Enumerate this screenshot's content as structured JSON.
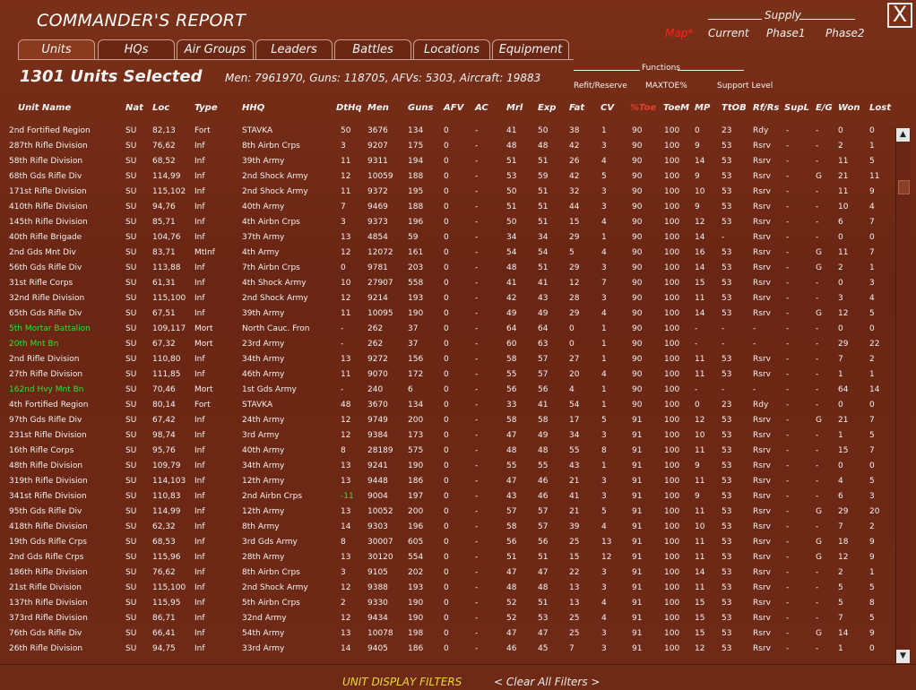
{
  "window": {
    "title": "COMMANDER'S REPORT",
    "close_label": "X"
  },
  "map_link": "Map*",
  "supply": {
    "title": "Supply",
    "options": [
      "Current",
      "Phase1",
      "Phase2"
    ]
  },
  "tabs": [
    "Units",
    "HQs",
    "Air Groups",
    "Leaders",
    "Battles",
    "Locations",
    "Equipment"
  ],
  "active_tab": "Units",
  "selection": {
    "count_label": "1301 Units Selected",
    "summary": "Men: 7961970, Guns: 118705, AFVs: 5303, Aircraft: 19883"
  },
  "functions": {
    "title": "Functions",
    "items": [
      "Refit/Reserve",
      "MAXTOE%",
      "Support Level"
    ]
  },
  "columns": [
    "Unit Name",
    "Nat",
    "Loc",
    "Type",
    "HHQ",
    "DtHq",
    "Men",
    "Guns",
    "AFV",
    "AC",
    "Mrl",
    "Exp",
    "Fat",
    "CV",
    "%Toe",
    "ToeM",
    "MP",
    "TtOB",
    "Rf/Rs",
    "SupL",
    "E/G",
    "Won",
    "Lost"
  ],
  "rows": [
    {
      "name": "2nd Fortified Region",
      "nat": "SU",
      "loc": "82,13",
      "type": "Fort",
      "hhq": "STAVKA",
      "dthq": "50",
      "men": "3676",
      "guns": "134",
      "afv": "0",
      "ac": "-",
      "mrl": "41",
      "exp": "50",
      "fat": "38",
      "cv": "1",
      "toe": "90",
      "toem": "100",
      "mp": "0",
      "ttob": "23",
      "rf": "Rdy",
      "supl": "-",
      "eg": "-",
      "won": "0",
      "lost": "0",
      "green": false
    },
    {
      "name": "287th Rifle Division",
      "nat": "SU",
      "loc": "76,62",
      "type": "Inf",
      "hhq": "8th Airbn Crps",
      "dthq": "3",
      "men": "9207",
      "guns": "175",
      "afv": "0",
      "ac": "-",
      "mrl": "48",
      "exp": "48",
      "fat": "42",
      "cv": "3",
      "toe": "90",
      "toem": "100",
      "mp": "9",
      "ttob": "53",
      "rf": "Rsrv",
      "supl": "-",
      "eg": "-",
      "won": "2",
      "lost": "1",
      "green": false
    },
    {
      "name": "58th Rifle Division",
      "nat": "SU",
      "loc": "68,52",
      "type": "Inf",
      "hhq": "39th Army",
      "dthq": "11",
      "men": "9311",
      "guns": "194",
      "afv": "0",
      "ac": "-",
      "mrl": "51",
      "exp": "51",
      "fat": "26",
      "cv": "4",
      "toe": "90",
      "toem": "100",
      "mp": "14",
      "ttob": "53",
      "rf": "Rsrv",
      "supl": "-",
      "eg": "-",
      "won": "11",
      "lost": "5",
      "green": false
    },
    {
      "name": "68th Gds Rifle Div",
      "nat": "SU",
      "loc": "114,99",
      "type": "Inf",
      "hhq": "2nd Shock Army",
      "dthq": "12",
      "men": "10059",
      "guns": "188",
      "afv": "0",
      "ac": "-",
      "mrl": "53",
      "exp": "59",
      "fat": "42",
      "cv": "5",
      "toe": "90",
      "toem": "100",
      "mp": "9",
      "ttob": "53",
      "rf": "Rsrv",
      "supl": "-",
      "eg": "G",
      "won": "21",
      "lost": "11",
      "green": false
    },
    {
      "name": "171st Rifle Division",
      "nat": "SU",
      "loc": "115,102",
      "type": "Inf",
      "hhq": "2nd Shock Army",
      "dthq": "11",
      "men": "9372",
      "guns": "195",
      "afv": "0",
      "ac": "-",
      "mrl": "50",
      "exp": "51",
      "fat": "32",
      "cv": "3",
      "toe": "90",
      "toem": "100",
      "mp": "10",
      "ttob": "53",
      "rf": "Rsrv",
      "supl": "-",
      "eg": "-",
      "won": "11",
      "lost": "9",
      "green": false
    },
    {
      "name": "410th Rifle Division",
      "nat": "SU",
      "loc": "94,76",
      "type": "Inf",
      "hhq": "40th Army",
      "dthq": "7",
      "men": "9469",
      "guns": "188",
      "afv": "0",
      "ac": "-",
      "mrl": "51",
      "exp": "51",
      "fat": "44",
      "cv": "3",
      "toe": "90",
      "toem": "100",
      "mp": "9",
      "ttob": "53",
      "rf": "Rsrv",
      "supl": "-",
      "eg": "-",
      "won": "10",
      "lost": "4",
      "green": false
    },
    {
      "name": "145th Rifle Division",
      "nat": "SU",
      "loc": "85,71",
      "type": "Inf",
      "hhq": "4th Airbn Crps",
      "dthq": "3",
      "men": "9373",
      "guns": "196",
      "afv": "0",
      "ac": "-",
      "mrl": "50",
      "exp": "51",
      "fat": "15",
      "cv": "4",
      "toe": "90",
      "toem": "100",
      "mp": "12",
      "ttob": "53",
      "rf": "Rsrv",
      "supl": "-",
      "eg": "-",
      "won": "6",
      "lost": "7",
      "green": false
    },
    {
      "name": "40th Rifle Brigade",
      "nat": "SU",
      "loc": "104,76",
      "type": "Inf",
      "hhq": "37th Army",
      "dthq": "13",
      "men": "4854",
      "guns": "59",
      "afv": "0",
      "ac": "-",
      "mrl": "34",
      "exp": "34",
      "fat": "29",
      "cv": "1",
      "toe": "90",
      "toem": "100",
      "mp": "14",
      "ttob": "-",
      "rf": "Rsrv",
      "supl": "-",
      "eg": "-",
      "won": "0",
      "lost": "0",
      "green": false
    },
    {
      "name": "2nd Gds Mnt Div",
      "nat": "SU",
      "loc": "83,71",
      "type": "MtInf",
      "hhq": "4th Army",
      "dthq": "12",
      "men": "12072",
      "guns": "161",
      "afv": "0",
      "ac": "-",
      "mrl": "54",
      "exp": "54",
      "fat": "5",
      "cv": "4",
      "toe": "90",
      "toem": "100",
      "mp": "16",
      "ttob": "53",
      "rf": "Rsrv",
      "supl": "-",
      "eg": "G",
      "won": "11",
      "lost": "7",
      "green": false
    },
    {
      "name": "56th Gds Rifle Div",
      "nat": "SU",
      "loc": "113,88",
      "type": "Inf",
      "hhq": "7th Airbn Crps",
      "dthq": "0",
      "men": "9781",
      "guns": "203",
      "afv": "0",
      "ac": "-",
      "mrl": "48",
      "exp": "51",
      "fat": "29",
      "cv": "3",
      "toe": "90",
      "toem": "100",
      "mp": "14",
      "ttob": "53",
      "rf": "Rsrv",
      "supl": "-",
      "eg": "G",
      "won": "2",
      "lost": "1",
      "green": false
    },
    {
      "name": "31st Rifle Corps",
      "nat": "SU",
      "loc": "61,31",
      "type": "Inf",
      "hhq": "4th Shock Army",
      "dthq": "10",
      "men": "27907",
      "guns": "558",
      "afv": "0",
      "ac": "-",
      "mrl": "41",
      "exp": "41",
      "fat": "12",
      "cv": "7",
      "toe": "90",
      "toem": "100",
      "mp": "15",
      "ttob": "53",
      "rf": "Rsrv",
      "supl": "-",
      "eg": "-",
      "won": "0",
      "lost": "3",
      "green": false
    },
    {
      "name": "32nd Rifle Division",
      "nat": "SU",
      "loc": "115,100",
      "type": "Inf",
      "hhq": "2nd Shock Army",
      "dthq": "12",
      "men": "9214",
      "guns": "193",
      "afv": "0",
      "ac": "-",
      "mrl": "42",
      "exp": "43",
      "fat": "28",
      "cv": "3",
      "toe": "90",
      "toem": "100",
      "mp": "11",
      "ttob": "53",
      "rf": "Rsrv",
      "supl": "-",
      "eg": "-",
      "won": "3",
      "lost": "4",
      "green": false
    },
    {
      "name": "65th Gds Rifle Div",
      "nat": "SU",
      "loc": "67,51",
      "type": "Inf",
      "hhq": "39th Army",
      "dthq": "11",
      "men": "10095",
      "guns": "190",
      "afv": "0",
      "ac": "-",
      "mrl": "49",
      "exp": "49",
      "fat": "29",
      "cv": "4",
      "toe": "90",
      "toem": "100",
      "mp": "14",
      "ttob": "53",
      "rf": "Rsrv",
      "supl": "-",
      "eg": "G",
      "won": "12",
      "lost": "5",
      "green": false
    },
    {
      "name": "5th Mortar Battalion",
      "nat": "SU",
      "loc": "109,117",
      "type": "Mort",
      "hhq": "North Cauc. Fron",
      "dthq": "-",
      "men": "262",
      "guns": "37",
      "afv": "0",
      "ac": "-",
      "mrl": "64",
      "exp": "64",
      "fat": "0",
      "cv": "1",
      "toe": "90",
      "toem": "100",
      "mp": "-",
      "ttob": "-",
      "rf": "-",
      "supl": "-",
      "eg": "-",
      "won": "0",
      "lost": "0",
      "green": true
    },
    {
      "name": "20th Mnt Bn",
      "nat": "SU",
      "loc": "67,32",
      "type": "Mort",
      "hhq": "23rd Army",
      "dthq": "-",
      "men": "262",
      "guns": "37",
      "afv": "0",
      "ac": "-",
      "mrl": "60",
      "exp": "63",
      "fat": "0",
      "cv": "1",
      "toe": "90",
      "toem": "100",
      "mp": "-",
      "ttob": "-",
      "rf": "-",
      "supl": "-",
      "eg": "-",
      "won": "29",
      "lost": "22",
      "green": true
    },
    {
      "name": "2nd Rifle Division",
      "nat": "SU",
      "loc": "110,80",
      "type": "Inf",
      "hhq": "34th Army",
      "dthq": "13",
      "men": "9272",
      "guns": "156",
      "afv": "0",
      "ac": "-",
      "mrl": "58",
      "exp": "57",
      "fat": "27",
      "cv": "1",
      "toe": "90",
      "toem": "100",
      "mp": "11",
      "ttob": "53",
      "rf": "Rsrv",
      "supl": "-",
      "eg": "-",
      "won": "7",
      "lost": "2",
      "green": false
    },
    {
      "name": "27th Rifle Division",
      "nat": "SU",
      "loc": "111,85",
      "type": "Inf",
      "hhq": "46th Army",
      "dthq": "11",
      "men": "9070",
      "guns": "172",
      "afv": "0",
      "ac": "-",
      "mrl": "55",
      "exp": "57",
      "fat": "20",
      "cv": "4",
      "toe": "90",
      "toem": "100",
      "mp": "11",
      "ttob": "53",
      "rf": "Rsrv",
      "supl": "-",
      "eg": "-",
      "won": "1",
      "lost": "1",
      "green": false
    },
    {
      "name": "162nd Hvy Mnt Bn",
      "nat": "SU",
      "loc": "70,46",
      "type": "Mort",
      "hhq": "1st Gds Army",
      "dthq": "-",
      "men": "240",
      "guns": "6",
      "afv": "0",
      "ac": "-",
      "mrl": "56",
      "exp": "56",
      "fat": "4",
      "cv": "1",
      "toe": "90",
      "toem": "100",
      "mp": "-",
      "ttob": "-",
      "rf": "-",
      "supl": "-",
      "eg": "-",
      "won": "64",
      "lost": "14",
      "green": true
    },
    {
      "name": "4th Fortified Region",
      "nat": "SU",
      "loc": "80,14",
      "type": "Fort",
      "hhq": "STAVKA",
      "dthq": "48",
      "men": "3670",
      "guns": "134",
      "afv": "0",
      "ac": "-",
      "mrl": "33",
      "exp": "41",
      "fat": "54",
      "cv": "1",
      "toe": "90",
      "toem": "100",
      "mp": "0",
      "ttob": "23",
      "rf": "Rdy",
      "supl": "-",
      "eg": "-",
      "won": "0",
      "lost": "0",
      "green": false
    },
    {
      "name": "97th Gds Rifle Div",
      "nat": "SU",
      "loc": "67,42",
      "type": "Inf",
      "hhq": "24th Army",
      "dthq": "12",
      "men": "9749",
      "guns": "200",
      "afv": "0",
      "ac": "-",
      "mrl": "58",
      "exp": "58",
      "fat": "17",
      "cv": "5",
      "toe": "91",
      "toem": "100",
      "mp": "12",
      "ttob": "53",
      "rf": "Rsrv",
      "supl": "-",
      "eg": "G",
      "won": "21",
      "lost": "7",
      "green": false
    },
    {
      "name": "231st Rifle Division",
      "nat": "SU",
      "loc": "98,74",
      "type": "Inf",
      "hhq": "3rd Army",
      "dthq": "12",
      "men": "9384",
      "guns": "173",
      "afv": "0",
      "ac": "-",
      "mrl": "47",
      "exp": "49",
      "fat": "34",
      "cv": "3",
      "toe": "91",
      "toem": "100",
      "mp": "10",
      "ttob": "53",
      "rf": "Rsrv",
      "supl": "-",
      "eg": "-",
      "won": "1",
      "lost": "5",
      "green": false
    },
    {
      "name": "16th Rifle Corps",
      "nat": "SU",
      "loc": "95,76",
      "type": "Inf",
      "hhq": "40th Army",
      "dthq": "8",
      "men": "28189",
      "guns": "575",
      "afv": "0",
      "ac": "-",
      "mrl": "48",
      "exp": "48",
      "fat": "55",
      "cv": "8",
      "toe": "91",
      "toem": "100",
      "mp": "11",
      "ttob": "53",
      "rf": "Rsrv",
      "supl": "-",
      "eg": "-",
      "won": "15",
      "lost": "7",
      "green": false
    },
    {
      "name": "48th Rifle Division",
      "nat": "SU",
      "loc": "109,79",
      "type": "Inf",
      "hhq": "34th Army",
      "dthq": "13",
      "men": "9241",
      "guns": "190",
      "afv": "0",
      "ac": "-",
      "mrl": "55",
      "exp": "55",
      "fat": "43",
      "cv": "1",
      "toe": "91",
      "toem": "100",
      "mp": "9",
      "ttob": "53",
      "rf": "Rsrv",
      "supl": "-",
      "eg": "-",
      "won": "0",
      "lost": "0",
      "green": false
    },
    {
      "name": "319th Rifle Division",
      "nat": "SU",
      "loc": "114,103",
      "type": "Inf",
      "hhq": "12th Army",
      "dthq": "13",
      "men": "9448",
      "guns": "186",
      "afv": "0",
      "ac": "-",
      "mrl": "47",
      "exp": "46",
      "fat": "21",
      "cv": "3",
      "toe": "91",
      "toem": "100",
      "mp": "11",
      "ttob": "53",
      "rf": "Rsrv",
      "supl": "-",
      "eg": "-",
      "won": "4",
      "lost": "5",
      "green": false
    },
    {
      "name": "341st Rifle Division",
      "nat": "SU",
      "loc": "110,83",
      "type": "Inf",
      "hhq": "2nd Airbn Crps",
      "dthq": "-11",
      "men": "9004",
      "guns": "197",
      "afv": "0",
      "ac": "-",
      "mrl": "43",
      "exp": "46",
      "fat": "41",
      "cv": "3",
      "toe": "91",
      "toem": "100",
      "mp": "9",
      "ttob": "53",
      "rf": "Rsrv",
      "supl": "-",
      "eg": "-",
      "won": "6",
      "lost": "3",
      "green": false
    },
    {
      "name": "95th Gds Rifle Div",
      "nat": "SU",
      "loc": "114,99",
      "type": "Inf",
      "hhq": "12th Army",
      "dthq": "13",
      "men": "10052",
      "guns": "200",
      "afv": "0",
      "ac": "-",
      "mrl": "57",
      "exp": "57",
      "fat": "21",
      "cv": "5",
      "toe": "91",
      "toem": "100",
      "mp": "11",
      "ttob": "53",
      "rf": "Rsrv",
      "supl": "-",
      "eg": "G",
      "won": "29",
      "lost": "20",
      "green": false
    },
    {
      "name": "418th Rifle Division",
      "nat": "SU",
      "loc": "62,32",
      "type": "Inf",
      "hhq": "8th Army",
      "dthq": "14",
      "men": "9303",
      "guns": "196",
      "afv": "0",
      "ac": "-",
      "mrl": "58",
      "exp": "57",
      "fat": "39",
      "cv": "4",
      "toe": "91",
      "toem": "100",
      "mp": "10",
      "ttob": "53",
      "rf": "Rsrv",
      "supl": "-",
      "eg": "-",
      "won": "7",
      "lost": "2",
      "green": false
    },
    {
      "name": "19th Gds Rifle Crps",
      "nat": "SU",
      "loc": "68,53",
      "type": "Inf",
      "hhq": "3rd Gds Army",
      "dthq": "8",
      "men": "30007",
      "guns": "605",
      "afv": "0",
      "ac": "-",
      "mrl": "56",
      "exp": "56",
      "fat": "25",
      "cv": "13",
      "toe": "91",
      "toem": "100",
      "mp": "11",
      "ttob": "53",
      "rf": "Rsrv",
      "supl": "-",
      "eg": "G",
      "won": "18",
      "lost": "9",
      "green": false
    },
    {
      "name": "2nd Gds Rifle Crps",
      "nat": "SU",
      "loc": "115,96",
      "type": "Inf",
      "hhq": "28th Army",
      "dthq": "13",
      "men": "30120",
      "guns": "554",
      "afv": "0",
      "ac": "-",
      "mrl": "51",
      "exp": "51",
      "fat": "15",
      "cv": "12",
      "toe": "91",
      "toem": "100",
      "mp": "11",
      "ttob": "53",
      "rf": "Rsrv",
      "supl": "-",
      "eg": "G",
      "won": "12",
      "lost": "9",
      "green": false
    },
    {
      "name": "186th Rifle Division",
      "nat": "SU",
      "loc": "76,62",
      "type": "Inf",
      "hhq": "8th Airbn Crps",
      "dthq": "3",
      "men": "9105",
      "guns": "202",
      "afv": "0",
      "ac": "-",
      "mrl": "47",
      "exp": "47",
      "fat": "22",
      "cv": "3",
      "toe": "91",
      "toem": "100",
      "mp": "14",
      "ttob": "53",
      "rf": "Rsrv",
      "supl": "-",
      "eg": "-",
      "won": "2",
      "lost": "1",
      "green": false
    },
    {
      "name": "21st Rifle Division",
      "nat": "SU",
      "loc": "115,100",
      "type": "Inf",
      "hhq": "2nd Shock Army",
      "dthq": "12",
      "men": "9388",
      "guns": "193",
      "afv": "0",
      "ac": "-",
      "mrl": "48",
      "exp": "48",
      "fat": "13",
      "cv": "3",
      "toe": "91",
      "toem": "100",
      "mp": "11",
      "ttob": "53",
      "rf": "Rsrv",
      "supl": "-",
      "eg": "-",
      "won": "5",
      "lost": "5",
      "green": false
    },
    {
      "name": "137th Rifle Division",
      "nat": "SU",
      "loc": "115,95",
      "type": "Inf",
      "hhq": "5th Airbn Crps",
      "dthq": "2",
      "men": "9330",
      "guns": "190",
      "afv": "0",
      "ac": "-",
      "mrl": "52",
      "exp": "51",
      "fat": "13",
      "cv": "4",
      "toe": "91",
      "toem": "100",
      "mp": "15",
      "ttob": "53",
      "rf": "Rsrv",
      "supl": "-",
      "eg": "-",
      "won": "5",
      "lost": "8",
      "green": false
    },
    {
      "name": "373rd Rifle Division",
      "nat": "SU",
      "loc": "86,71",
      "type": "Inf",
      "hhq": "32nd Army",
      "dthq": "12",
      "men": "9434",
      "guns": "190",
      "afv": "0",
      "ac": "-",
      "mrl": "52",
      "exp": "53",
      "fat": "25",
      "cv": "4",
      "toe": "91",
      "toem": "100",
      "mp": "15",
      "ttob": "53",
      "rf": "Rsrv",
      "supl": "-",
      "eg": "-",
      "won": "7",
      "lost": "5",
      "green": false
    },
    {
      "name": "76th Gds Rifle Div",
      "nat": "SU",
      "loc": "66,41",
      "type": "Inf",
      "hhq": "54th Army",
      "dthq": "13",
      "men": "10078",
      "guns": "198",
      "afv": "0",
      "ac": "-",
      "mrl": "47",
      "exp": "47",
      "fat": "25",
      "cv": "3",
      "toe": "91",
      "toem": "100",
      "mp": "15",
      "ttob": "53",
      "rf": "Rsrv",
      "supl": "-",
      "eg": "G",
      "won": "14",
      "lost": "9",
      "green": false
    },
    {
      "name": "26th Rifle Division",
      "nat": "SU",
      "loc": "94,75",
      "type": "Inf",
      "hhq": "33rd Army",
      "dthq": "14",
      "men": "9405",
      "guns": "186",
      "afv": "0",
      "ac": "-",
      "mrl": "46",
      "exp": "45",
      "fat": "7",
      "cv": "3",
      "toe": "91",
      "toem": "100",
      "mp": "12",
      "ttob": "53",
      "rf": "Rsrv",
      "supl": "-",
      "eg": "-",
      "won": "1",
      "lost": "0",
      "green": false
    }
  ],
  "footer": {
    "filters_label": "UNIT DISPLAY FILTERS",
    "clear_label": "< Clear All Filters >"
  },
  "scroll": {
    "up_glyph": "▲",
    "down_glyph": "▼"
  },
  "colors": {
    "background": "#6e2a15",
    "accent_red": "#e0402c",
    "green_unit": "#2fe02f",
    "filter_yellow": "#e8d838"
  }
}
